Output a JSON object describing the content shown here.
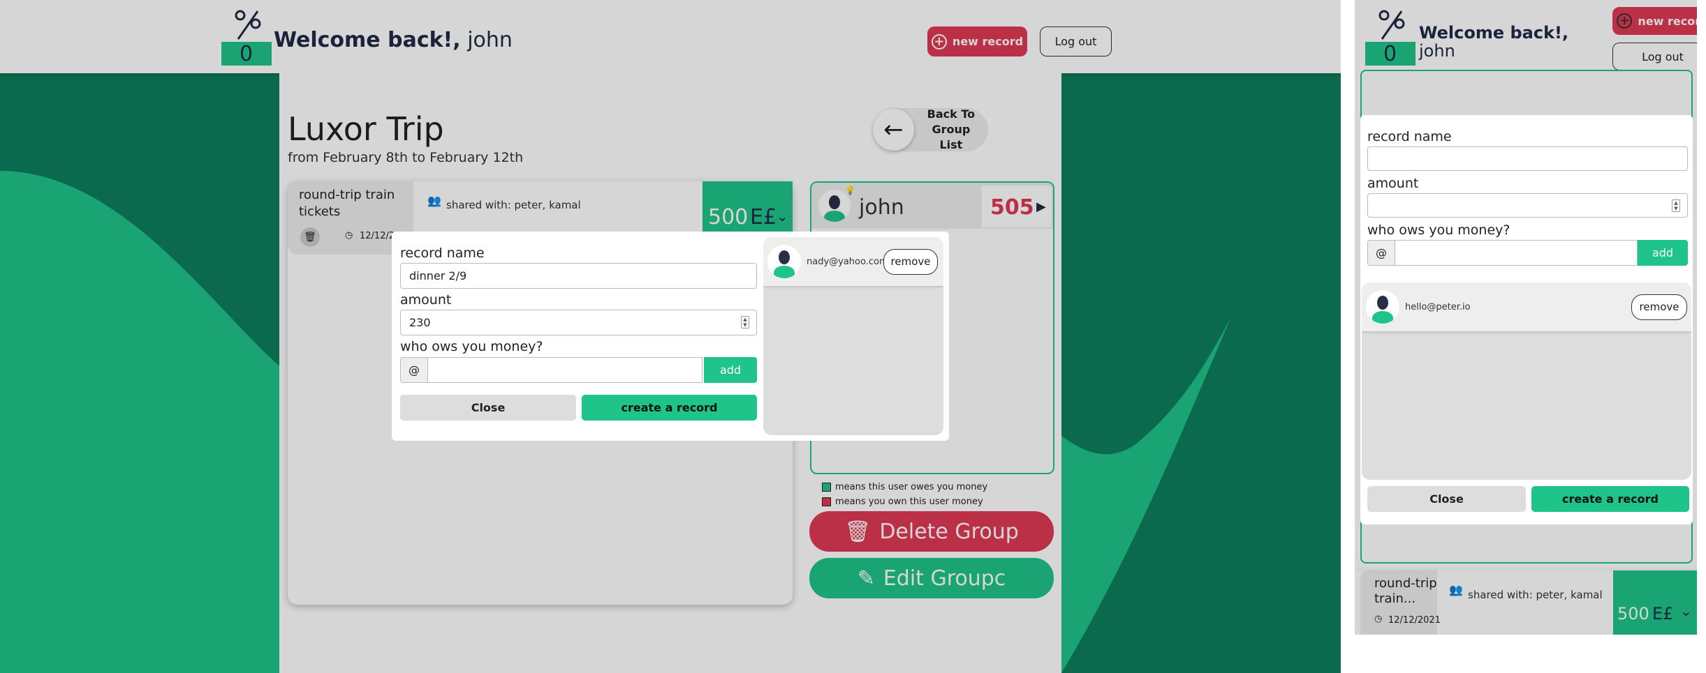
{
  "header": {
    "welcome_bold": "Welcome back!,",
    "username": "john",
    "new_record_label": "new record",
    "logout_label": "Log out"
  },
  "group": {
    "title": "Luxor Trip",
    "dates": "from February 8th to February 12th",
    "back_label_line1": "Back To",
    "back_label_line2": "Group List"
  },
  "record": {
    "name": "round-trip train tickets",
    "name_short": "round-trip train...",
    "shared_with": "shared with: peter, kamal",
    "date": "12/12/2021",
    "date_short": "12/12/2",
    "amount": "500",
    "currency": "E£"
  },
  "balance": {
    "user": "john",
    "amount": "505"
  },
  "legend": {
    "owes_you": "means this user owes you money",
    "you_owe": "means you own this user money"
  },
  "actions": {
    "delete_group": "Delete Group",
    "edit_group": "Edit Groupc"
  },
  "modal_desktop": {
    "record_name_label": "record name",
    "record_name_value": "dinner 2/9",
    "amount_label": "amount",
    "amount_value": "230",
    "who_label": "who ows you money?",
    "at_symbol": "@",
    "add_label": "add",
    "close_label": "Close",
    "create_label": "create a record",
    "owers": [
      {
        "email": "nady@yahoo.com",
        "remove_label": "remove"
      }
    ]
  },
  "modal_mobile": {
    "record_name_label": "record name",
    "amount_label": "amount",
    "who_label": "who ows you money?",
    "at_symbol": "@",
    "add_label": "add",
    "close_label": "Close",
    "create_label": "create a record",
    "owers": [
      {
        "email": "hello@peter.io",
        "remove_label": "remove"
      }
    ]
  },
  "colors": {
    "brand_green": "#1fc48b",
    "danger_red": "#e03a55",
    "dark_green_bg": "#0e7f5c"
  }
}
